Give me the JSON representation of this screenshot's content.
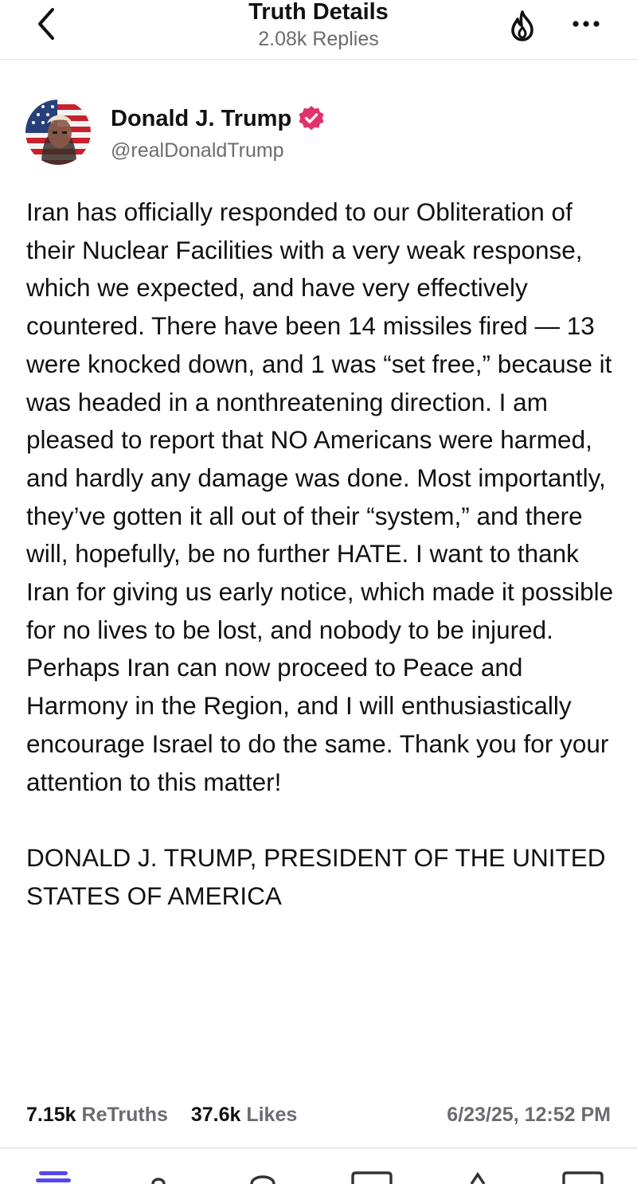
{
  "header": {
    "title": "Truth Details",
    "subtitle": "2.08k Replies",
    "back_icon": "chevron-left-icon",
    "fire_icon": "fire-icon",
    "more_icon": "ellipsis-icon"
  },
  "author": {
    "name": "Donald J. Trump",
    "handle": "@realDonaldTrump",
    "verified_icon": "verified-badge-icon",
    "verified_color": "#e0336b"
  },
  "post": {
    "body": "Iran has officially responded to our Obliteration of their Nuclear Facilities with a very weak response, which we expected, and have very effectively countered. There have been 14 missiles fired — 13 were knocked down, and 1 was “set free,” because it was headed in a nonthreatening direction. I am pleased to report that NO Americans were harmed, and hardly any damage was done. Most importantly, they’ve gotten it all out of their “system,” and there will, hopefully, be no further HATE. I want to thank Iran for giving us early notice, which made it possible for no lives to be lost, and nobody to be injured. Perhaps Iran can now proceed to Peace and Harmony in the Region, and I will enthusiastically encourage Israel to do the same. Thank you for your attention to this matter!",
    "signature": "DONALD J. TRUMP, PRESIDENT OF THE UNITED STATES OF AMERICA"
  },
  "stats": {
    "retruths_count": "7.15k",
    "retruths_label": "ReTruths",
    "likes_count": "37.6k",
    "likes_label": "Likes",
    "timestamp": "6/23/25, 12:52 PM"
  },
  "tabbar": {
    "accent": "#5448ee",
    "icons": [
      "home-icon",
      "search-icon",
      "notifications-icon",
      "messages-icon",
      "compose-icon",
      "menu-icon"
    ]
  }
}
